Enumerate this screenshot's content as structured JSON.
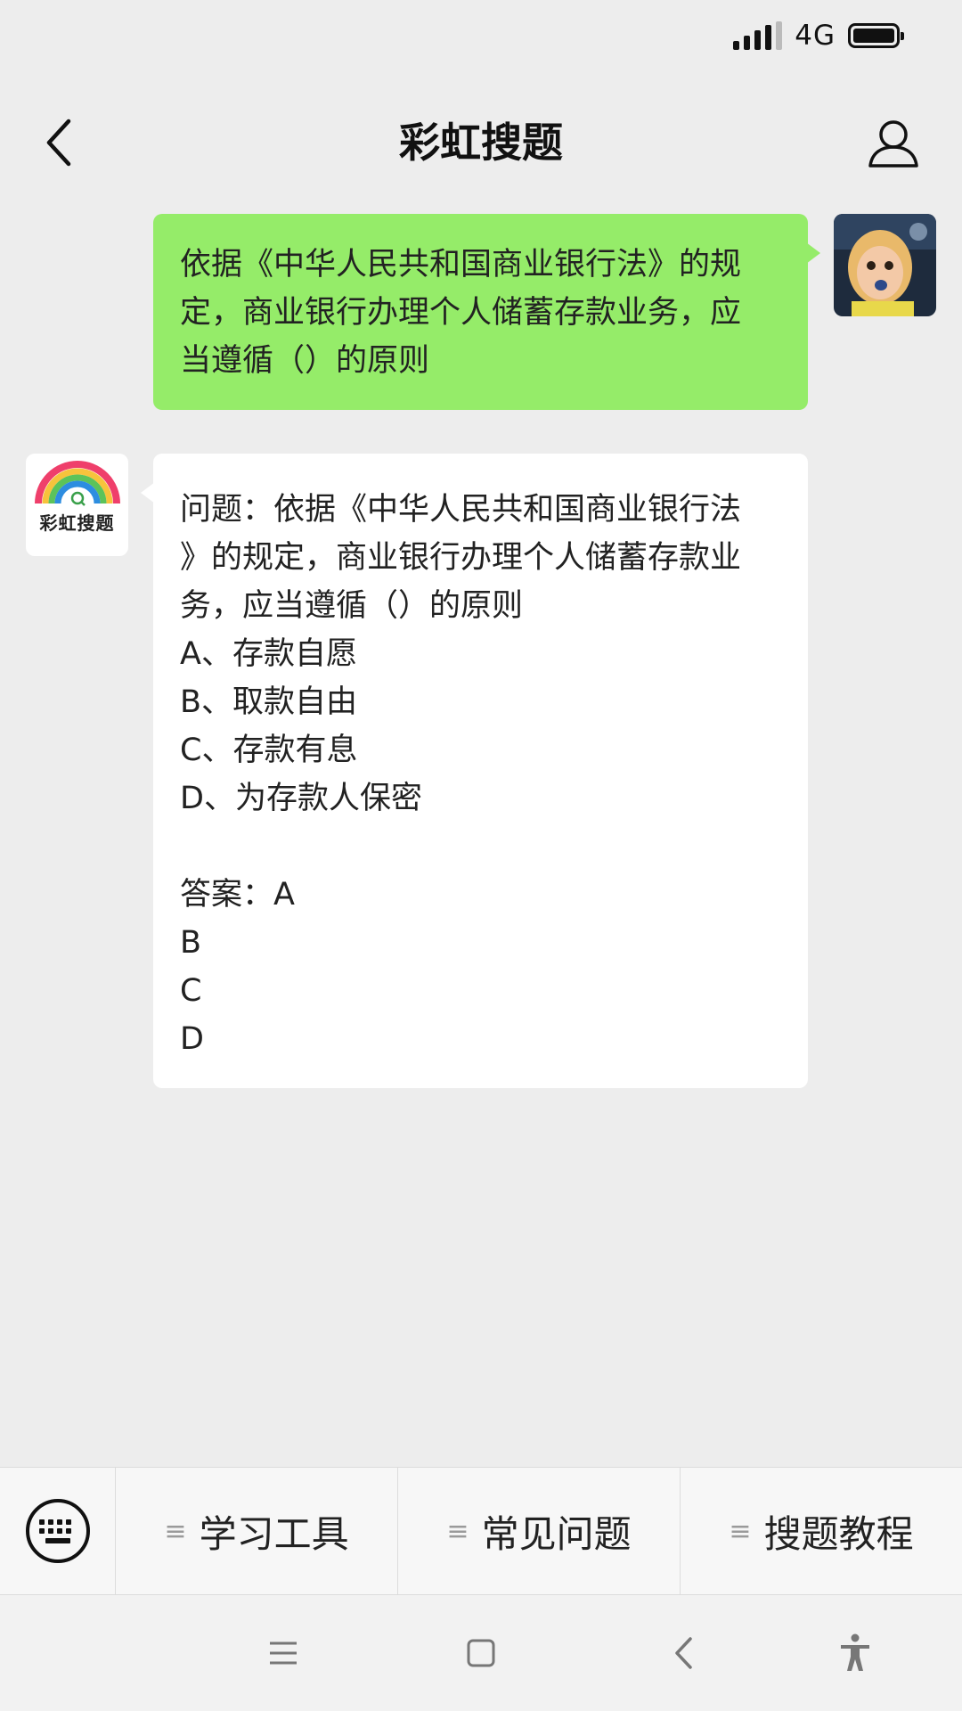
{
  "status_bar": {
    "network": "4G",
    "icons": [
      "signal-icon",
      "battery-icon"
    ]
  },
  "header": {
    "title": "彩虹搜题",
    "left_icon": "back-chevron-icon",
    "right_icon": "person-icon"
  },
  "chat": {
    "user_message": {
      "lines": [
        "依据《中华人民共和国商业银行法》的规",
        "定，商业银行办理个人储蓄存款业务，应",
        "当遵循（）的原则"
      ]
    },
    "bot": {
      "avatar_label": "彩虹搜题",
      "avatar_icon": "rainbow-logo-icon"
    },
    "bot_message": {
      "lines": [
        "问题：依据《中华人民共和国商业银行法",
        "》的规定，商业银行办理个人储蓄存款业",
        "务，应当遵循（）的原则",
        "A、存款自愿",
        "B、取款自由",
        "C、存款有息",
        "D、为存款人保密",
        "",
        "答案：A",
        "B",
        "C",
        "D"
      ]
    }
  },
  "menu": {
    "keyboard_icon": "keyboard-icon",
    "items": [
      {
        "label": "学习工具",
        "icon": "menu-lines-icon"
      },
      {
        "label": "常见问题",
        "icon": "menu-lines-icon"
      },
      {
        "label": "搜题教程",
        "icon": "menu-lines-icon"
      }
    ]
  },
  "nav": {
    "icons": [
      "recent-apps-icon",
      "home-icon",
      "back-icon",
      "accessibility-icon"
    ]
  },
  "colors": {
    "background": "#ededed",
    "outgoing_bubble": "#95ec69",
    "incoming_bubble": "#ffffff",
    "text": "#222222"
  }
}
